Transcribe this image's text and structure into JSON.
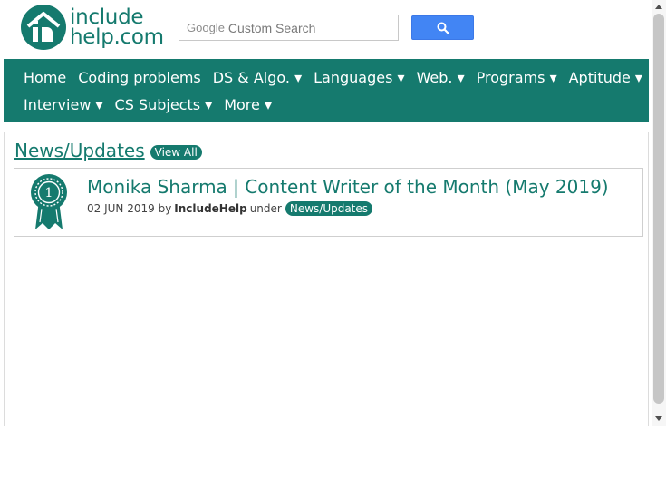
{
  "brand": {
    "logo_line1": "include",
    "logo_line2": "help.com",
    "color": "#157a6e"
  },
  "search": {
    "brand_label": "Google",
    "placeholder": "Custom Search",
    "button_icon": "search-icon",
    "button_color": "#4285f4"
  },
  "nav": {
    "row1": [
      "Home",
      "Coding problems",
      "DS & Algo. ▾",
      "Languages ▾",
      "Web. ▾",
      "Programs ▾",
      "Aptitude ▾"
    ],
    "row2": [
      "Interview ▾",
      "CS Subjects ▾",
      "More ▾"
    ]
  },
  "section": {
    "title": "News/Updates",
    "view_all_label": "View All"
  },
  "post": {
    "badge_icon": "award-ribbon-icon",
    "badge_number": "1",
    "title": "Monika Sharma | Content Writer of the Month (May 2019)",
    "date": "02 JUN 2019",
    "by_label": "by",
    "author": "IncludeHelp",
    "under_label": "under",
    "category": "News/Updates"
  }
}
